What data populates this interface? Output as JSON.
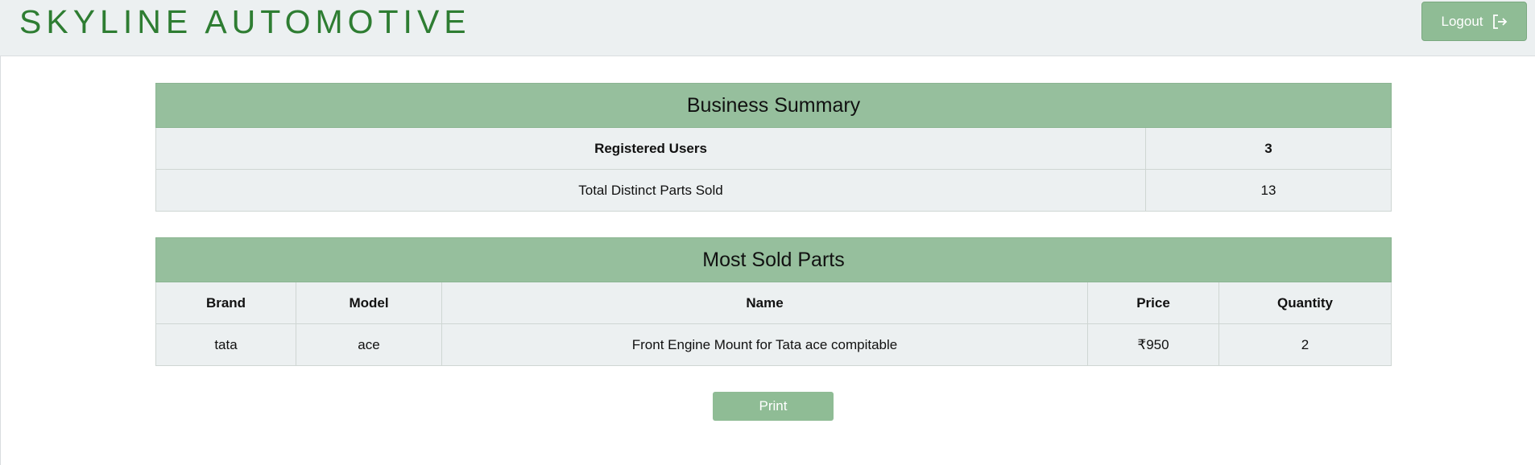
{
  "header": {
    "brand": "SKYLINE AUTOMOTIVE",
    "logout_label": "Logout",
    "logout_icon": "logout-icon"
  },
  "summary": {
    "title": "Business Summary",
    "rows": [
      {
        "label": "Registered Users",
        "value": "3"
      },
      {
        "label": "Total Distinct Parts Sold",
        "value": "13"
      }
    ]
  },
  "parts": {
    "title": "Most Sold Parts",
    "columns": [
      "Brand",
      "Model",
      "Name",
      "Price",
      "Quantity"
    ],
    "rows": [
      {
        "brand": "tata",
        "model": "ace",
        "name": "Front Engine Mount for Tata ace compitable",
        "price": "₹950",
        "quantity": "2"
      }
    ]
  },
  "actions": {
    "print_label": "Print"
  },
  "colors": {
    "brand": "#2e7d32",
    "accent": "#96bf9d",
    "button": "#8fbc95",
    "panel_bg": "#ecf0f1"
  }
}
